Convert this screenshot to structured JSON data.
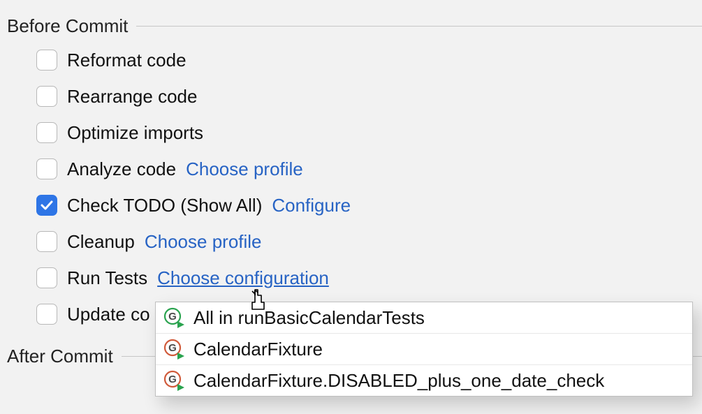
{
  "sections": {
    "before_label": "Before Commit",
    "after_label": "After Commit"
  },
  "options": {
    "reformat": "Reformat code",
    "rearrange": "Rearrange code",
    "optimize": "Optimize imports",
    "analyze": {
      "label": "Analyze code",
      "link": "Choose profile"
    },
    "todo": {
      "label": "Check TODO (Show All)",
      "link": "Configure"
    },
    "cleanup": {
      "label": "Cleanup",
      "link": "Choose profile"
    },
    "run_tests": {
      "label": "Run Tests",
      "link": "Choose configuration"
    },
    "update_partial": "Update co"
  },
  "popup": {
    "items": [
      "All in runBasicCalendarTests",
      "CalendarFixture",
      "CalendarFixture.DISABLED_plus_one_date_check"
    ]
  }
}
